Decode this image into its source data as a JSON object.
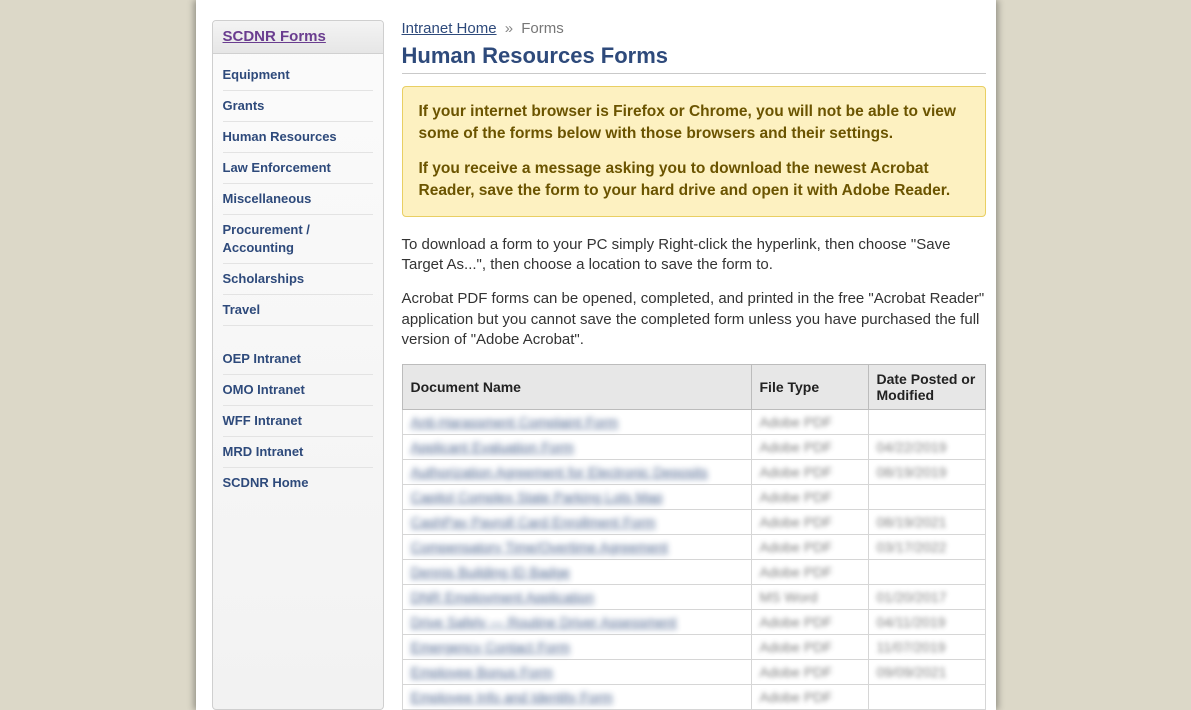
{
  "sidebar": {
    "title": "SCDNR Forms",
    "nav1": [
      {
        "label": "Equipment"
      },
      {
        "label": "Grants"
      },
      {
        "label": "Human Resources"
      },
      {
        "label": "Law Enforcement"
      },
      {
        "label": "Miscellaneous"
      },
      {
        "label": "Procurement / Accounting"
      },
      {
        "label": "Scholarships"
      },
      {
        "label": "Travel"
      }
    ],
    "nav2": [
      {
        "label": "OEP Intranet"
      },
      {
        "label": "OMO Intranet"
      },
      {
        "label": "WFF Intranet"
      },
      {
        "label": "MRD Intranet"
      },
      {
        "label": "SCDNR Home"
      }
    ]
  },
  "breadcrumb": {
    "home": "Intranet Home",
    "sep": "»",
    "current": "Forms"
  },
  "page_title": "Human Resources Forms",
  "warning": {
    "p1": "If your internet browser is Firefox or Chrome, you will not be able to view some of the forms below with those browsers and their settings.",
    "p2": "If you receive a message asking you to download the newest Acrobat Reader, save the form to your hard drive and open it with Adobe Reader."
  },
  "intro": {
    "p1": "To download a form to your PC simply Right-click the hyperlink, then choose \"Save Target As...\", then choose a location to save the form to.",
    "p2": "Acrobat PDF forms can be opened, completed, and printed in the free \"Acrobat Reader\" application but you cannot save the completed form unless you have purchased the full version of \"Adobe Acrobat\"."
  },
  "table": {
    "headers": {
      "name": "Document Name",
      "type": "File Type",
      "date": "Date Posted or Modified"
    },
    "rows": [
      {
        "name": "Anti-Harassment Complaint Form",
        "type": "Adobe PDF",
        "date": ""
      },
      {
        "name": "Applicant Evaluation Form",
        "type": "Adobe PDF",
        "date": "04/22/2019"
      },
      {
        "name": "Authorization Agreement for Electronic Deposits",
        "type": "Adobe PDF",
        "date": "08/19/2019"
      },
      {
        "name": "Capitol Complex State Parking Lots Map",
        "type": "Adobe PDF",
        "date": ""
      },
      {
        "name": "CashPay Payroll Card Enrollment Form",
        "type": "Adobe PDF",
        "date": "08/19/2021"
      },
      {
        "name": "Compensatory Time/Overtime Agreement",
        "type": "Adobe PDF",
        "date": "03/17/2022"
      },
      {
        "name": "Dennis Building ID Badge",
        "type": "Adobe PDF",
        "date": ""
      },
      {
        "name": "DNR Employment Application",
        "type": "MS Word",
        "date": "01/20/2017"
      },
      {
        "name": "Drive Safely — Routine Driver Assessment",
        "type": "Adobe PDF",
        "date": "04/11/2019"
      },
      {
        "name": "Emergency Contact Form",
        "type": "Adobe PDF",
        "date": "11/07/2019"
      },
      {
        "name": "Employee Bonus Form",
        "type": "Adobe PDF",
        "date": "09/09/2021"
      },
      {
        "name": "Employee Info and Identity Form",
        "type": "Adobe PDF",
        "date": ""
      }
    ]
  }
}
